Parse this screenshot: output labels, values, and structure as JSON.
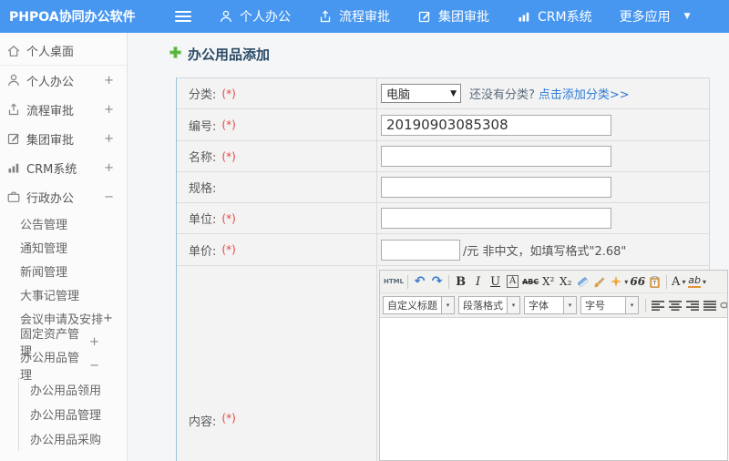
{
  "colors": {
    "header_bg": "#4797f0",
    "link_blue": "#2e7cd5",
    "required_red": "#e64545",
    "title_navy": "#2b4b67",
    "plus_green": "#55b335"
  },
  "header": {
    "logo": "PHPOA协同办公软件",
    "nav": [
      {
        "label": "个人办公",
        "icon": "user-icon"
      },
      {
        "label": "流程审批",
        "icon": "share-icon"
      },
      {
        "label": "集团审批",
        "icon": "edit-icon"
      },
      {
        "label": "CRM系统",
        "icon": "chart-icon"
      },
      {
        "label": "更多应用",
        "icon": "caret-down-icon",
        "caret": "▼"
      }
    ]
  },
  "sidebar": {
    "top_items": [
      {
        "label": "个人桌面",
        "icon": "home-icon",
        "expand": ""
      },
      {
        "label": "个人办公",
        "icon": "user-icon",
        "expand": "+"
      },
      {
        "label": "流程审批",
        "icon": "share-icon",
        "expand": "+"
      },
      {
        "label": "集团审批",
        "icon": "edit-icon",
        "expand": "+"
      },
      {
        "label": "CRM系统",
        "icon": "chart-icon",
        "expand": "+"
      },
      {
        "label": "行政办公",
        "icon": "briefcase-icon",
        "expand": "−"
      }
    ],
    "admin_submenu": [
      {
        "label": "公告管理",
        "expand": ""
      },
      {
        "label": "通知管理",
        "expand": ""
      },
      {
        "label": "新闻管理",
        "expand": ""
      },
      {
        "label": "大事记管理",
        "expand": ""
      },
      {
        "label": "会议申请及安排",
        "expand": "+"
      },
      {
        "label": "固定资产管理",
        "expand": "+"
      },
      {
        "label": "办公用品管理",
        "expand": "−"
      }
    ],
    "supplies_submenu": [
      {
        "label": "办公用品领用"
      },
      {
        "label": "办公用品管理"
      },
      {
        "label": "办公用品采购"
      }
    ]
  },
  "form": {
    "title": "办公用品添加",
    "rows": {
      "category": {
        "label": "分类:",
        "required": "(*)"
      },
      "number": {
        "label": "编号:",
        "required": "(*)"
      },
      "name": {
        "label": "名称:",
        "required": "(*)"
      },
      "spec": {
        "label": "规格:",
        "required": ""
      },
      "unit": {
        "label": "单位:",
        "required": "(*)"
      },
      "price": {
        "label": "单价:",
        "required": "(*)"
      },
      "content": {
        "label": "内容:",
        "required": "(*)"
      }
    },
    "category_select_value": "电脑",
    "category_select_caret": "▼",
    "category_hint": "还没有分类?",
    "category_link": "点击添加分类>>",
    "number_value": "20190903085308",
    "name_value": "",
    "spec_value": "",
    "unit_value": "",
    "price_value": "",
    "price_suffix": "/元 非中文，如填写格式\"2.68\""
  },
  "editor": {
    "toolbar1_icons": [
      "html-source",
      "undo",
      "redo",
      "bold",
      "italic",
      "underline",
      "font-box",
      "strikethrough",
      "superscript",
      "subscript",
      "eraser",
      "format-painter",
      "quick-format",
      "blockquote",
      "paste-plain-text",
      "font-color",
      "highlight-color"
    ],
    "toolbar2_icons": [
      "heading-select",
      "paragraph-select",
      "font-family-select",
      "font-size-select",
      "align-left",
      "align-center",
      "align-right",
      "align-justify",
      "insert-link"
    ],
    "glyphs": {
      "source": "HTML",
      "undo": "↶",
      "redo": "↷",
      "bold": "B",
      "italic": "I",
      "underline": "U",
      "fontbox": "A",
      "strikethrough": "ABC",
      "superscript": "X²",
      "subscript": "X₂",
      "quote": "66",
      "fontcolor": "A",
      "highlight": "ab",
      "caret": "▾"
    },
    "selects": {
      "heading": "自定义标题",
      "paragraph": "段落格式",
      "font": "字体",
      "size": "字号"
    }
  }
}
